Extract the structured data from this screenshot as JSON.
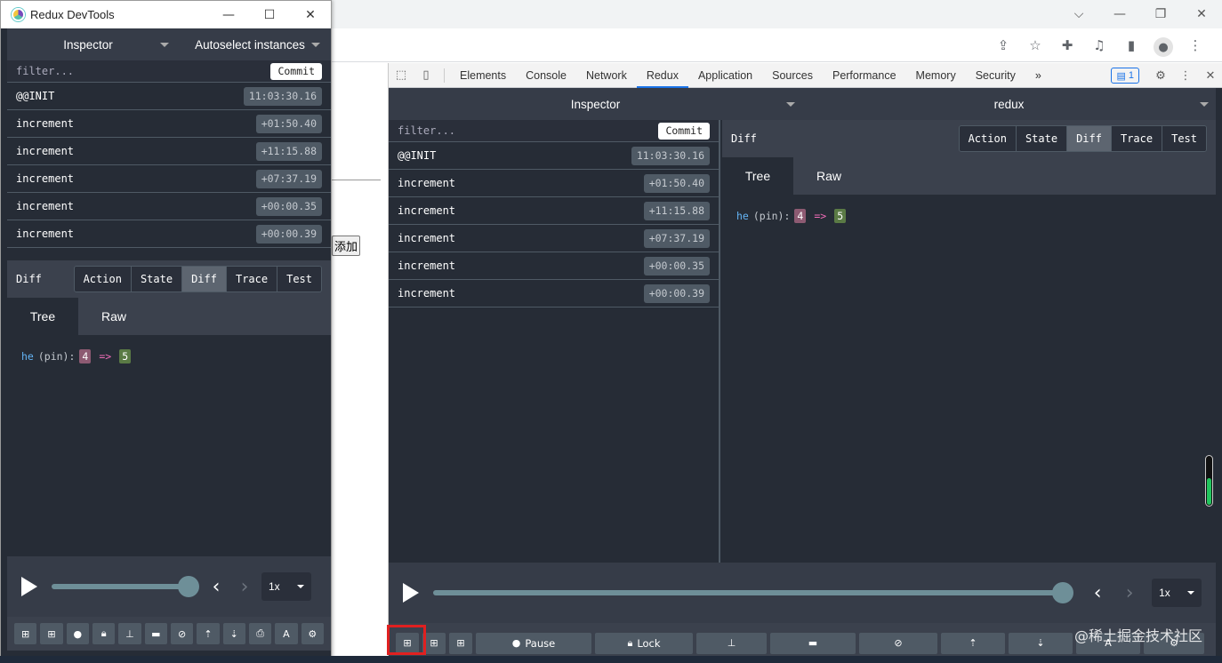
{
  "browser": {
    "window_controls": [
      "⌵",
      "—",
      "❐",
      "✕"
    ],
    "toolbar_icons": [
      "share-icon",
      "star-icon",
      "puzzle-icon",
      "media-icon",
      "sidepanel-icon",
      "profile-icon",
      "more-icon"
    ],
    "page": {
      "add_button_label": "添加"
    }
  },
  "devtools": {
    "tabs": [
      "Elements",
      "Console",
      "Network",
      "Redux",
      "Application",
      "Sources",
      "Performance",
      "Memory",
      "Security"
    ],
    "active_tab": "Redux",
    "more_tabs": "»",
    "issues_count": "1",
    "close": "✕"
  },
  "redux": {
    "header": {
      "left": "Inspector",
      "right": "redux"
    },
    "filter_placeholder": "filter...",
    "commit_label": "Commit",
    "actions": [
      {
        "name": "@@INIT",
        "time": "11:03:30.16"
      },
      {
        "name": "increment",
        "time": "+01:50.40"
      },
      {
        "name": "increment",
        "time": "+11:15.88"
      },
      {
        "name": "increment",
        "time": "+07:37.19"
      },
      {
        "name": "increment",
        "time": "+00:00.35"
      },
      {
        "name": "increment",
        "time": "+00:00.39"
      }
    ],
    "diff_title": "Diff",
    "monitor_tabs": [
      "Action",
      "State",
      "Diff",
      "Trace",
      "Test"
    ],
    "active_monitor_tab": "Diff",
    "view_tabs": [
      "Tree",
      "Raw"
    ],
    "active_view_tab": "Tree",
    "diff": {
      "key": "he",
      "sep": "(pin):",
      "old": "4",
      "arrow": "=>",
      "new": "5"
    },
    "slider": {
      "position_fraction": 1.0,
      "speed": "1x"
    },
    "bottom_buttons": {
      "pause": "Pause",
      "lock": "Lock"
    }
  },
  "popup_window": {
    "title": "Redux DevTools",
    "header": {
      "left": "Inspector",
      "right": "Autoselect instances"
    },
    "speed": "1x"
  },
  "watermark": "@稀土掘金技术社区",
  "colors": {
    "panel_bg": "#262c36",
    "header_bg": "#363c48",
    "subbar_bg": "#3b414d",
    "active_tab_underline": "#1a73e8",
    "highlight_box": "#e02020"
  }
}
